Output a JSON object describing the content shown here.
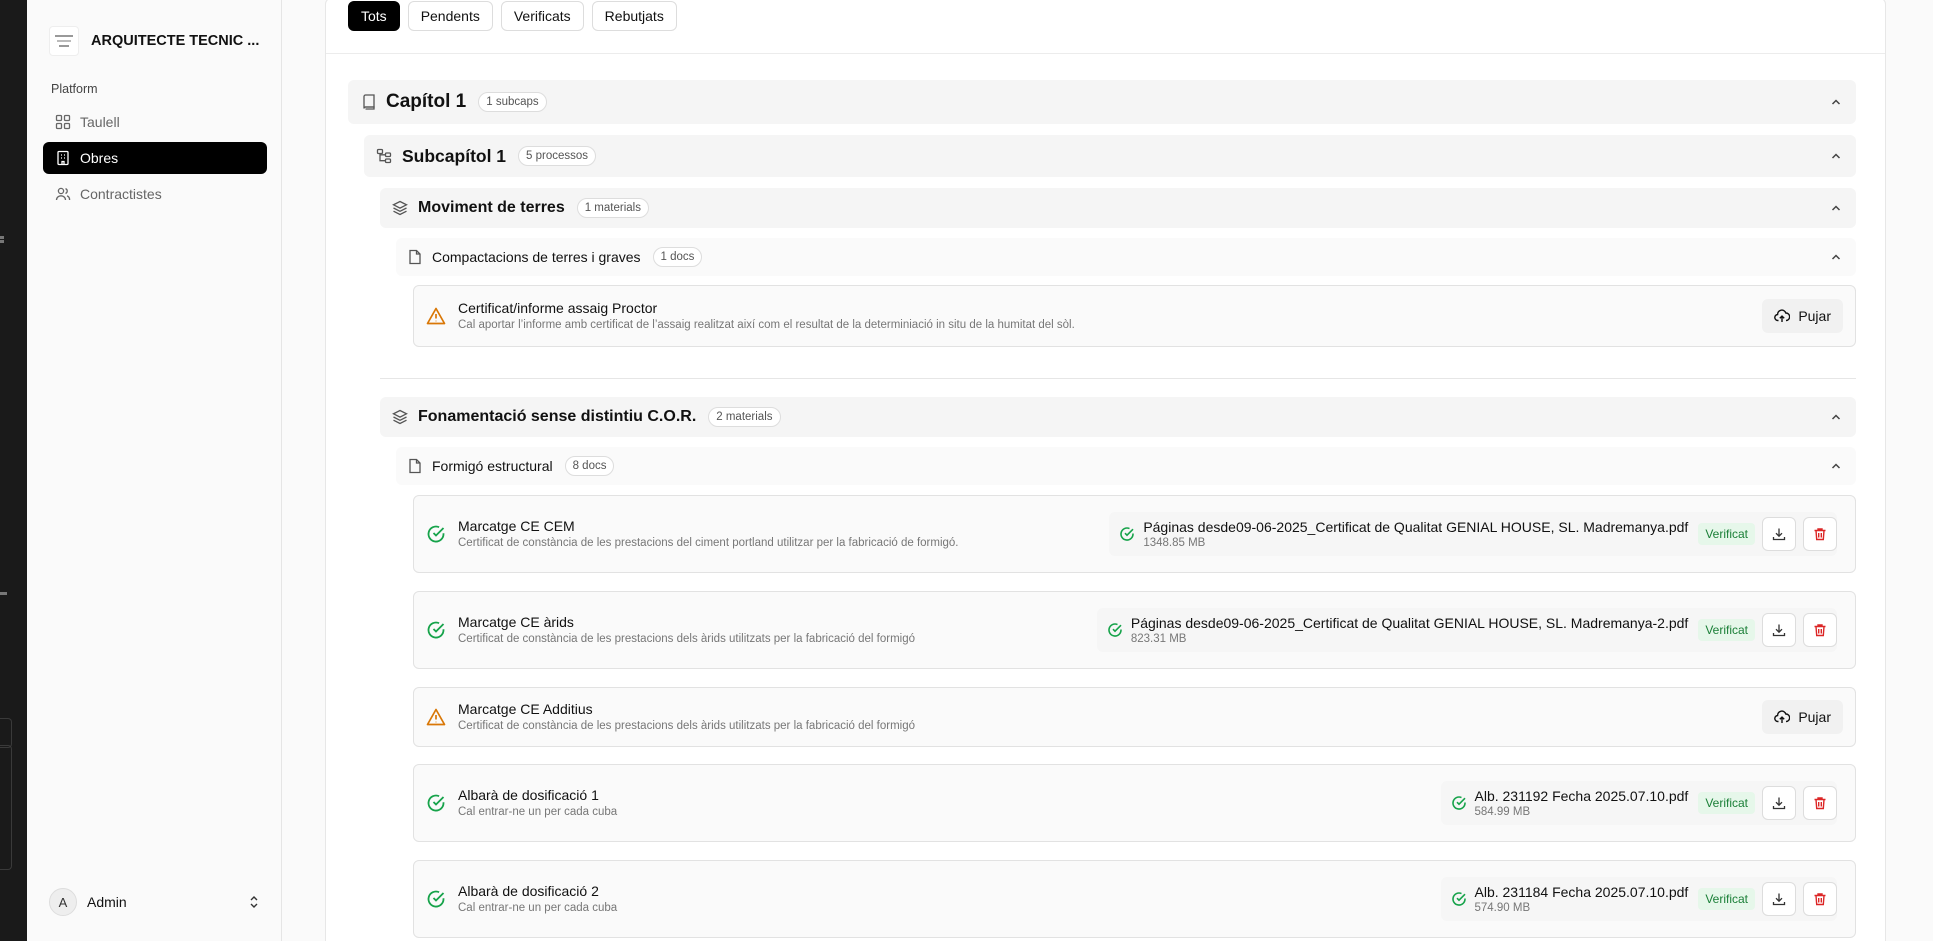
{
  "sidebar": {
    "brand": "ARQUITECTE TECNIC ...",
    "section_label": "Platform",
    "items": [
      {
        "label": "Taulell",
        "icon": "dashboard-icon"
      },
      {
        "label": "Obres",
        "icon": "building-icon"
      },
      {
        "label": "Contractistes",
        "icon": "users-icon"
      }
    ],
    "active_index": 1,
    "user": {
      "initial": "A",
      "name": "Admin"
    }
  },
  "tabs": [
    "Tots",
    "Pendents",
    "Verificats",
    "Rebutjats"
  ],
  "active_tab": 0,
  "chapter": {
    "title": "Capítol 1",
    "count": "1 subcaps"
  },
  "subchapter": {
    "title": "Subcapítol 1",
    "count": "5 processos"
  },
  "processes": [
    {
      "title": "Moviment de terres",
      "count": "1 materials",
      "material": {
        "title": "Compactacions de terres i graves",
        "count": "1 docs"
      },
      "docs": [
        {
          "status": "pending",
          "title": "Certificat/informe assaig Proctor",
          "desc": "Cal aportar l’informe amb certificat de l’assaig realitzat així com el resultat de la determiniació in situ de la humitat del sòl.",
          "upload_label": "Pujar"
        }
      ]
    },
    {
      "title": "Fonamentació sense distintiu C.O.R.",
      "count": "2 materials",
      "material": {
        "title": "Formigó estructural",
        "count": "8 docs"
      },
      "docs": [
        {
          "status": "verified",
          "title": "Marcatge CE CEM",
          "desc": "Certificat de constància de les prestacions del ciment portland utilitzar per la fabricació de formigó.",
          "file_name": "Páginas desde09-06-2025_Certificat de Qualitat GENIAL HOUSE, SL. Madremanya.pdf",
          "file_size": "1348.85 MB",
          "badge": "Verificat"
        },
        {
          "status": "verified",
          "title": "Marcatge CE àrids",
          "desc": "Certificat de constància de les prestacions dels àrids utilitzats per la fabricació del formigó",
          "file_name": "Páginas desde09-06-2025_Certificat de Qualitat GENIAL HOUSE, SL. Madremanya-2.pdf",
          "file_size": "823.31 MB",
          "badge": "Verificat"
        },
        {
          "status": "pending",
          "title": "Marcatge CE Additius",
          "desc": "Certificat de constància de les prestacions dels àrids utilitzats per la fabricació del formigó",
          "upload_label": "Pujar"
        },
        {
          "status": "verified",
          "title": "Albarà de dosificació 1",
          "desc": "Cal entrar-ne un per cada cuba",
          "file_name": "Alb. 231192 Fecha 2025.07.10.pdf",
          "file_size": "584.99 MB",
          "badge": "Verificat"
        },
        {
          "status": "verified",
          "title": "Albarà de dosificació 2",
          "desc": "Cal entrar-ne un per cada cuba",
          "file_name": "Alb. 231184 Fecha 2025.07.10.pdf",
          "file_size": "574.90 MB",
          "badge": "Verificat"
        }
      ]
    }
  ],
  "colors": {
    "accent": "#000000",
    "verified": "#16a34a",
    "warning": "#d97706",
    "danger": "#dc2626"
  }
}
